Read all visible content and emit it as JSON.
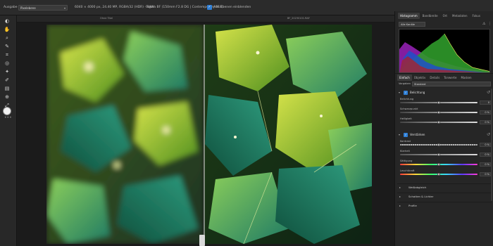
{
  "toolbar": {
    "output_label": "Ausgabe",
    "output_value": "Pixelebene",
    "image_info": "6040 × 4000 px, 24.40 MP, RGBA/32 (HDR) - RAW",
    "lens_info": "Sigma BF (150mm F2.8 DG | Contemporary 018)",
    "all_layers_checkbox": "Alle Ebenen einblenden"
  },
  "strip": {
    "left_file": "Ohne Titel",
    "right_file": "BF_20230101.RAF"
  },
  "tools": [
    {
      "name": "develop-persona-icon",
      "glyph": "◐"
    },
    {
      "name": "hand-tool-icon",
      "glyph": "✋"
    },
    {
      "name": "zoom-tool-icon",
      "glyph": "⌕"
    },
    {
      "name": "white-balance-tool-icon",
      "glyph": "✎"
    },
    {
      "name": "crop-tool-icon",
      "glyph": "⌗"
    },
    {
      "name": "red-eye-tool-icon",
      "glyph": "◎"
    },
    {
      "name": "blemish-tool-icon",
      "glyph": "✦"
    },
    {
      "name": "brush-tool-icon",
      "glyph": "✐"
    },
    {
      "name": "gradient-tool-icon",
      "glyph": "▤"
    },
    {
      "name": "overlay-tool-icon",
      "glyph": "⊕"
    },
    {
      "name": "transform-tool-icon",
      "glyph": "⤢"
    }
  ],
  "panel": {
    "tabs": [
      "Histogramm",
      "Bandbreite",
      "Ort",
      "Metadaten",
      "Fokus"
    ],
    "histogram_mode": "Alle Kanäle",
    "tabs2": [
      "Einfach",
      "Objektiv",
      "Details",
      "Tonwerte",
      "Masken"
    ],
    "preset_label": "Vorgaben",
    "preset_value": "Standard",
    "exposure": {
      "title": "Belichtung",
      "rows": [
        {
          "label": "Belichtung",
          "value": "0",
          "pos": 0.5
        },
        {
          "label": "Schwarzpunkt",
          "value": "0 %",
          "pos": 0.5
        },
        {
          "label": "Helligkeit",
          "value": "0 %",
          "pos": 0.5
        }
      ]
    },
    "enhance": {
      "title": "Verstärken",
      "rows": [
        {
          "label": "Kontrast",
          "value": "0 %",
          "pos": 0.5
        },
        {
          "label": "Klarheit",
          "value": "0 %",
          "pos": 0.5
        },
        {
          "label": "Sättigung",
          "value": "0 %",
          "pos": 0.5
        },
        {
          "label": "Leuchtkraft",
          "value": "0 %",
          "pos": 0.5
        }
      ]
    },
    "collapsed": [
      "Weißabgleich",
      "Schatten & Lichter",
      "Profile"
    ]
  }
}
